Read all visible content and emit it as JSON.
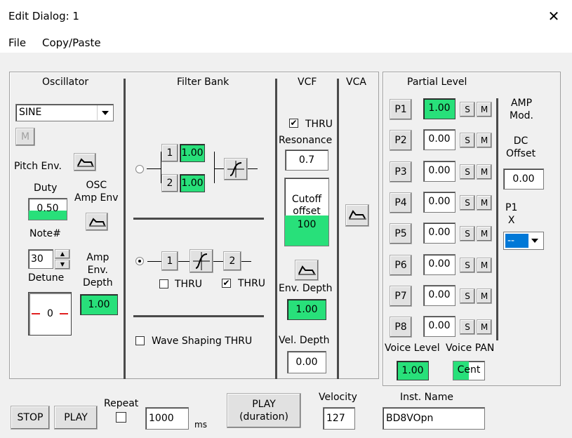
{
  "window": {
    "title": "Edit Dialog: 1",
    "close_glyph": "✕"
  },
  "menu": [
    "File",
    "Copy/Paste"
  ],
  "oscillator": {
    "header": "Oscillator",
    "waveform": "SINE",
    "m_button": "M",
    "pitch_env": "Pitch Env.",
    "duty_label": "Duty",
    "duty_value": "0.50",
    "duty_fill": 0.45,
    "osc_amp_env": "OSC\nAmp Env",
    "note_label": "Note#",
    "note_value": "30",
    "detune_label": "Detune",
    "detune_value": "0",
    "amp_env_depth_label": "Amp\nEnv.\nDepth",
    "amp_env_depth_value": "1.00"
  },
  "filter_bank": {
    "header": "Filter Bank",
    "f1": "1",
    "f1_value": "1.00",
    "f2": "2",
    "f2_value": "1.00",
    "s1": "1",
    "s2": "2",
    "thru1": "THRU",
    "thru1_checked": false,
    "thru2": "THRU",
    "thru2_checked": true,
    "wave_shaping": "Wave Shaping THRU",
    "wave_shaping_checked": false
  },
  "vcf": {
    "header": "VCF",
    "thru": "THRU",
    "thru_checked": true,
    "resonance_label": "Resonance",
    "resonance_value": "0.7",
    "cutoff_label": "Cutoff\noffset",
    "cutoff_value": "100",
    "cutoff_fill": 0.45,
    "env_depth_label": "Env. Depth",
    "env_depth_value": "1.00",
    "vel_depth_label": "Vel. Depth",
    "vel_depth_value": "0.00"
  },
  "vca": {
    "header": "VCA"
  },
  "partials": {
    "header": "Partial Level",
    "rows": [
      {
        "label": "P1",
        "value": "1.00",
        "active": true
      },
      {
        "label": "P2",
        "value": "0.00",
        "active": false
      },
      {
        "label": "P3",
        "value": "0.00",
        "active": false
      },
      {
        "label": "P4",
        "value": "0.00",
        "active": false
      },
      {
        "label": "P5",
        "value": "0.00",
        "active": false
      },
      {
        "label": "P6",
        "value": "0.00",
        "active": false
      },
      {
        "label": "P7",
        "value": "0.00",
        "active": false
      },
      {
        "label": "P8",
        "value": "0.00",
        "active": false
      }
    ],
    "s": "S",
    "m": "M",
    "amp_mod": "AMP\nMod.",
    "dc_offset_label": "DC\nOffset",
    "dc_offset_value": "0.00",
    "p1x_label": "P1\nX",
    "p1x_value": "--",
    "voice_level_label": "Voice Level",
    "voice_level_value": "1.00",
    "voice_pan_label": "Voice PAN",
    "voice_pan_value": "Cent"
  },
  "bottom": {
    "stop": "STOP",
    "play": "PLAY",
    "repeat_label": "Repeat",
    "repeat_value": "1000",
    "ms": "ms",
    "play_duration": "PLAY\n(duration)",
    "velocity_label": "Velocity",
    "velocity_value": "127",
    "inst_name_label": "Inst. Name",
    "inst_name_value": "BD8VOpn"
  },
  "colors": {
    "green": "#28e07a",
    "selected_blue": "#0078d7"
  }
}
